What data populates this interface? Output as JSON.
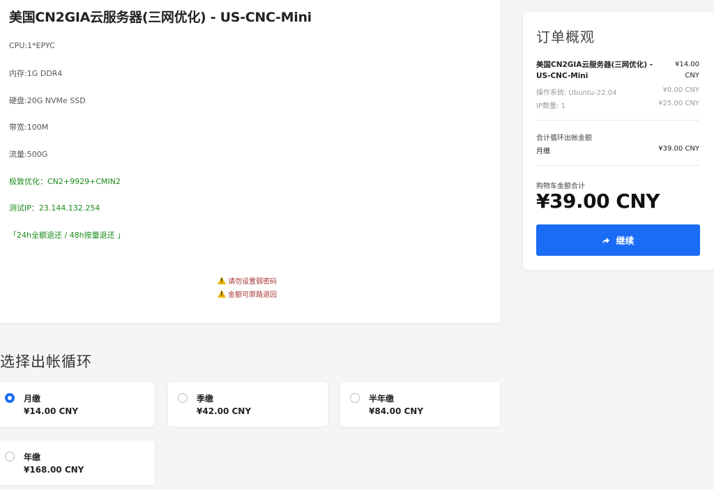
{
  "product": {
    "title": "美国CN2GIA云服务器(三网优化) - US-CNC-Mini",
    "specs": [
      "CPU:1*EPYC",
      "内存:1G DDR4",
      "硬盘:20G NVMe SSD",
      "带宽:100M",
      "流量:500G"
    ],
    "highlights": [
      "极致优化：CN2+9929+CMIN2",
      "测试IP：23.144.132.254",
      "「24h全额退还 / 48h按量退还 」"
    ],
    "warnings": [
      "请勿设置弱密码",
      "金额可原路退回"
    ]
  },
  "billing": {
    "heading": "选择出帐循环",
    "options": [
      {
        "name": "月缴",
        "price": "¥14.00 CNY",
        "checked": true
      },
      {
        "name": "季缴",
        "price": "¥42.00 CNY",
        "checked": false
      },
      {
        "name": "半年缴",
        "price": "¥84.00 CNY",
        "checked": false
      },
      {
        "name": "年缴",
        "price": "¥168.00 CNY",
        "checked": false
      }
    ]
  },
  "summary": {
    "title": "订单概观",
    "product_name": "美国CN2GIA云服务器(三网优化) - US-CNC-Mini",
    "product_price": "¥14.00 CNY",
    "os_label": "操作系统: Ubuntu-22.04",
    "os_price": "¥0.00 CNY",
    "ip_label": "IP数量: 1",
    "ip_price": "¥25.00 CNY",
    "recurring_label": "合计循环出帐金额",
    "cycle_label": "月缴",
    "cycle_price": "¥39.00 CNY",
    "total_label": "购物车金额合计",
    "total_amount": "¥39.00 CNY",
    "continue_label": "继续"
  },
  "colors": {
    "accent": "#1a6cf5",
    "highlight_green": "#1a8a1a",
    "warning_red": "#aa3333"
  }
}
